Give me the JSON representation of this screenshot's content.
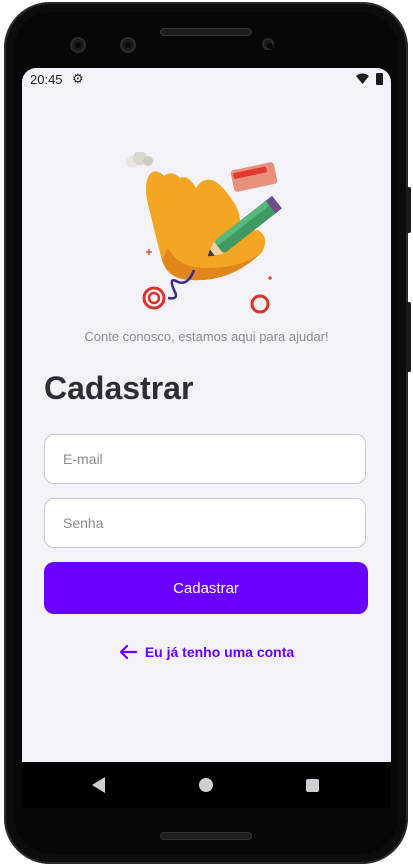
{
  "status_bar": {
    "time": "20:45",
    "settings_icon": "gear-icon",
    "wifi_icon": "wifi-icon",
    "battery_icon": "battery-icon"
  },
  "hero": {
    "illustration": "hand-with-pencil-illustration"
  },
  "subtitle": "Conte conosco, estamos aqui para ajudar!",
  "page_title": "Cadastrar",
  "form": {
    "email_placeholder": "E-mail",
    "password_placeholder": "Senha",
    "submit_label": "Cadastrar"
  },
  "login_link": {
    "label": "Eu já tenho uma conta",
    "icon": "arrow-left-icon"
  },
  "nav_bar": {
    "back_icon": "back-icon",
    "home_icon": "home-icon",
    "recents_icon": "recents-icon"
  },
  "colors": {
    "accent": "#6a00ff",
    "screen_bg": "#f3f2f8",
    "heading": "#2d2d35"
  }
}
